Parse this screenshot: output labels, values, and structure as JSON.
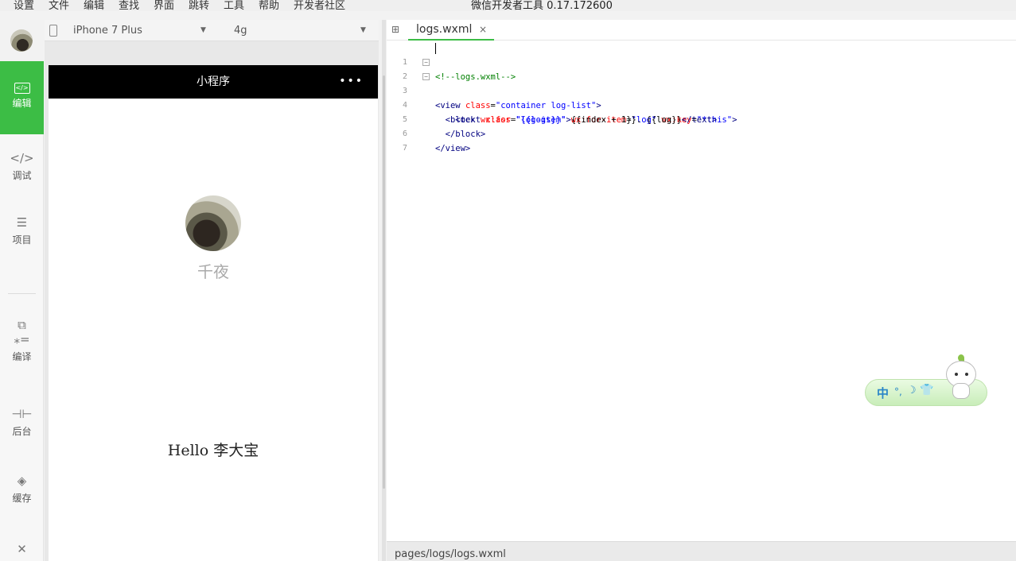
{
  "menubar": {
    "items": [
      "设置",
      "文件",
      "编辑",
      "查找",
      "界面",
      "跳转",
      "工具",
      "帮助",
      "开发者社区"
    ],
    "title": "微信开发者工具 0.17.172600"
  },
  "sidebar": {
    "items": [
      {
        "label": "编辑",
        "icon": "code-icon"
      },
      {
        "label": "调试",
        "icon": "debug-icon"
      },
      {
        "label": "项目",
        "icon": "menu-icon"
      },
      {
        "label": "编译",
        "icon": "compile-icon"
      },
      {
        "label": "后台",
        "icon": "backend-icon"
      },
      {
        "label": "缓存",
        "icon": "layers-icon"
      }
    ],
    "close_icon": "close-icon"
  },
  "simulator": {
    "device": "iPhone 7 Plus",
    "network": "4g",
    "nav_title": "小程序",
    "nav_more": "•••",
    "nickname": "千夜",
    "hello_text": "Hello 李大宝"
  },
  "editor": {
    "tab_label": "logs.wxml",
    "tab_close": "×",
    "line_numbers": [
      "1",
      "2",
      "3",
      "4",
      "5",
      "6",
      "7"
    ],
    "code": {
      "l1": "<!--logs.wxml-->",
      "l2_open": "<view ",
      "l2_attr": "class",
      "l2_eq": "=",
      "l2_val": "\"container log-list\"",
      "l2_close": ">",
      "l3_open": "  <block ",
      "l3_a1": "wx:for",
      "l3_v1": "\"{{logs}}\"",
      "l3_a2": "wx:for-item",
      "l3_v2": "\"log\"",
      "l3_a3": "wx:key",
      "l3_v3": "\"*this\"",
      "l3_close": ">",
      "l4_open": "    <text ",
      "l4_attr": "class",
      "l4_val": "\"log-item\"",
      "l4_close": ">",
      "l4_content": "{{index + 1}}. {{log}}",
      "l4_end": "</text>",
      "l5": "  </block>",
      "l6": "</view>"
    }
  },
  "statusbar": {
    "path": "pages/logs/logs.wxml"
  },
  "ime": {
    "lang": "中",
    "punc": "°,",
    "moon": "☽",
    "shirt": "👕"
  },
  "colors": {
    "accent": "#3cbd45",
    "nav_bg": "#000000",
    "tag": "#000080",
    "attr": "#ff0000",
    "value": "#0000ff",
    "comment": "#008000"
  }
}
